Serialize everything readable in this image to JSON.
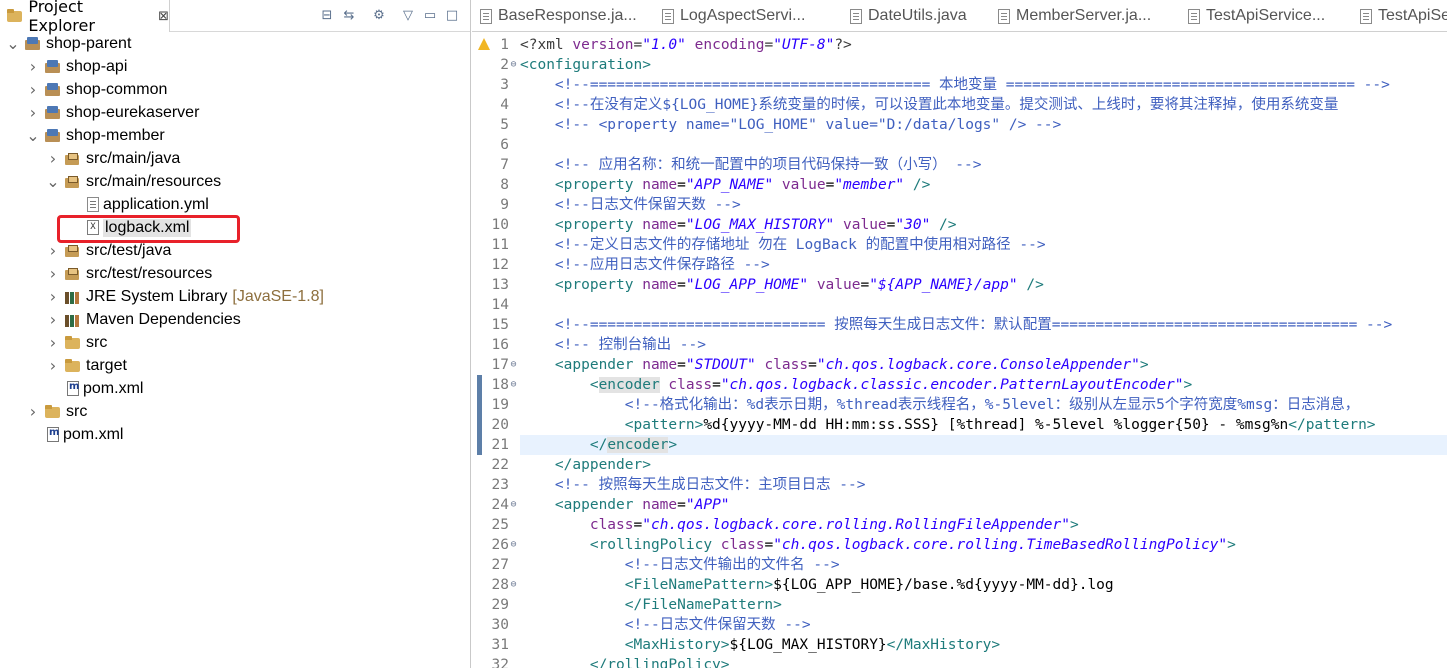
{
  "explorer": {
    "title": "Project Explorer",
    "close": "⊠",
    "toolbar": [
      "collapse-all-icon",
      "link-with-editor-icon",
      "filter-icon",
      "view-menu-icon",
      "minimize-icon",
      "maximize-icon"
    ],
    "tree": [
      {
        "label": "shop-parent",
        "icon": "project-icon",
        "indent": 0,
        "twisty": "v"
      },
      {
        "label": "shop-api",
        "icon": "project-icon",
        "indent": 1,
        "twisty": ">"
      },
      {
        "label": "shop-common",
        "icon": "project-icon",
        "indent": 1,
        "twisty": ">"
      },
      {
        "label": "shop-eurekaserver",
        "icon": "project-icon",
        "indent": 1,
        "twisty": ">"
      },
      {
        "label": "shop-member",
        "icon": "project-icon",
        "indent": 1,
        "twisty": "v"
      },
      {
        "label": "src/main/java",
        "icon": "package-folder-icon",
        "indent": 2,
        "twisty": ">"
      },
      {
        "label": "src/main/resources",
        "icon": "package-folder-icon",
        "indent": 2,
        "twisty": "v"
      },
      {
        "label": "application.yml",
        "icon": "file-icon",
        "indent": 3,
        "twisty": ""
      },
      {
        "label": "logback.xml",
        "icon": "xml-file-icon",
        "indent": 3,
        "twisty": "",
        "selected": true
      },
      {
        "label": "src/test/java",
        "icon": "package-folder-icon",
        "indent": 2,
        "twisty": ">"
      },
      {
        "label": "src/test/resources",
        "icon": "package-folder-icon",
        "indent": 2,
        "twisty": ">"
      },
      {
        "label": "JRE System Library",
        "decoration": "[JavaSE-1.8]",
        "icon": "library-icon",
        "indent": 2,
        "twisty": ">"
      },
      {
        "label": "Maven Dependencies",
        "icon": "library-icon",
        "indent": 2,
        "twisty": ">"
      },
      {
        "label": "src",
        "icon": "folder-icon",
        "indent": 2,
        "twisty": ">"
      },
      {
        "label": "target",
        "icon": "folder-icon",
        "indent": 2,
        "twisty": ">"
      },
      {
        "label": "pom.xml",
        "icon": "pom-file-icon",
        "indent": 2,
        "twisty": ""
      },
      {
        "label": "src",
        "icon": "folder-icon",
        "indent": 1,
        "twisty": ">"
      },
      {
        "label": "pom.xml",
        "icon": "pom-file-icon",
        "indent": 1,
        "twisty": ""
      }
    ]
  },
  "editor": {
    "tabs": [
      "BaseResponse.ja...",
      "LogAspectServi...",
      "DateUtils.java",
      "MemberServer.ja...",
      "TestApiService...",
      "TestApiSe"
    ],
    "lines": [
      [
        [
          "pi",
          "<?xml "
        ],
        [
          "attr",
          "version"
        ],
        [
          "pi",
          "="
        ],
        [
          "val",
          "\"1.0\""
        ],
        [
          "pi",
          " "
        ],
        [
          "attr",
          "encoding"
        ],
        [
          "pi",
          "="
        ],
        [
          "val",
          "\"UTF-8\""
        ],
        [
          "pi",
          "?>"
        ]
      ],
      [
        [
          "tag",
          "<configuration>"
        ]
      ],
      [
        [
          "cmt",
          "    <!--======================================= 本地变量 ======================================== -->"
        ]
      ],
      [
        [
          "cmt",
          "    <!--在没有定义${LOG_HOME}系统变量的时候，可以设置此本地变量。提交测试、上线时，要将其注释掉，使用系统变量"
        ]
      ],
      [
        [
          "cmt",
          "    <!-- <property name=\"LOG_HOME\" value=\"D:/data/logs\" /> -->"
        ]
      ],
      [
        [
          "txt",
          ""
        ]
      ],
      [
        [
          "cmt",
          "    <!-- 应用名称：和统一配置中的项目代码保持一致（小写） -->"
        ]
      ],
      [
        [
          "tag",
          "    <property "
        ],
        [
          "attr",
          "name"
        ],
        [
          "txt",
          "="
        ],
        [
          "val",
          "\"APP_NAME\""
        ],
        [
          "txt",
          " "
        ],
        [
          "attr",
          "value"
        ],
        [
          "txt",
          "="
        ],
        [
          "val",
          "\"member\""
        ],
        [
          "tag",
          " />"
        ]
      ],
      [
        [
          "cmt",
          "    <!--日志文件保留天数 -->"
        ]
      ],
      [
        [
          "tag",
          "    <property "
        ],
        [
          "attr",
          "name"
        ],
        [
          "txt",
          "="
        ],
        [
          "val",
          "\"LOG_MAX_HISTORY\""
        ],
        [
          "txt",
          " "
        ],
        [
          "attr",
          "value"
        ],
        [
          "txt",
          "="
        ],
        [
          "val",
          "\"30\""
        ],
        [
          "tag",
          " />"
        ]
      ],
      [
        [
          "cmt",
          "    <!--定义日志文件的存储地址 勿在 LogBack 的配置中使用相对路径 -->"
        ]
      ],
      [
        [
          "cmt",
          "    <!--应用日志文件保存路径 -->"
        ]
      ],
      [
        [
          "tag",
          "    <property "
        ],
        [
          "attr",
          "name"
        ],
        [
          "txt",
          "="
        ],
        [
          "val",
          "\"LOG_APP_HOME\""
        ],
        [
          "txt",
          " "
        ],
        [
          "attr",
          "value"
        ],
        [
          "txt",
          "="
        ],
        [
          "val",
          "\"${APP_NAME}/app\""
        ],
        [
          "tag",
          " />"
        ]
      ],
      [
        [
          "txt",
          ""
        ]
      ],
      [
        [
          "cmt",
          "    <!--=========================== 按照每天生成日志文件：默认配置=================================== -->"
        ]
      ],
      [
        [
          "cmt",
          "    <!-- 控制台输出 -->"
        ]
      ],
      [
        [
          "tag",
          "    <appender "
        ],
        [
          "attr",
          "name"
        ],
        [
          "txt",
          "="
        ],
        [
          "val",
          "\"STDOUT\""
        ],
        [
          "txt",
          " "
        ],
        [
          "attr",
          "class"
        ],
        [
          "txt",
          "="
        ],
        [
          "val",
          "\"ch.qos.logback.core.ConsoleAppender\""
        ],
        [
          "tag",
          ">"
        ]
      ],
      [
        [
          "tag",
          "        <"
        ],
        [
          "enc",
          "encoder"
        ],
        [
          "txt",
          " "
        ],
        [
          "attr",
          "class"
        ],
        [
          "txt",
          "="
        ],
        [
          "val",
          "\"ch.qos.logback.classic.encoder.PatternLayoutEncoder\""
        ],
        [
          "tag",
          ">"
        ]
      ],
      [
        [
          "cmt",
          "            <!--格式化输出：%d表示日期，%thread表示线程名，%-5level：级别从左显示5个字符宽度%msg：日志消息，"
        ]
      ],
      [
        [
          "tag",
          "            <pattern>"
        ],
        [
          "txt",
          "%d{yyyy-MM-dd HH:mm:ss.SSS} [%thread] %-5level %logger{50} - %msg%n"
        ],
        [
          "tag",
          "</pattern>"
        ]
      ],
      [
        [
          "tag",
          "        </"
        ],
        [
          "enc",
          "encoder"
        ],
        [
          "tag",
          ">"
        ]
      ],
      [
        [
          "tag",
          "    </appender>"
        ]
      ],
      [
        [
          "cmt",
          "    <!-- 按照每天生成日志文件：主项目日志 -->"
        ]
      ],
      [
        [
          "tag",
          "    <appender "
        ],
        [
          "attr",
          "name"
        ],
        [
          "txt",
          "="
        ],
        [
          "val",
          "\"APP\""
        ]
      ],
      [
        [
          "txt",
          "        "
        ],
        [
          "attr",
          "class"
        ],
        [
          "txt",
          "="
        ],
        [
          "val",
          "\"ch.qos.logback.core.rolling.RollingFileAppender\""
        ],
        [
          "tag",
          ">"
        ]
      ],
      [
        [
          "tag",
          "        <rollingPolicy "
        ],
        [
          "attr",
          "class"
        ],
        [
          "txt",
          "="
        ],
        [
          "val",
          "\"ch.qos.logback.core.rolling.TimeBasedRollingPolicy\""
        ],
        [
          "tag",
          ">"
        ]
      ],
      [
        [
          "cmt",
          "            <!--日志文件输出的文件名 -->"
        ]
      ],
      [
        [
          "tag",
          "            <FileNamePattern>"
        ],
        [
          "txt",
          "${LOG_APP_HOME}/base.%d{yyyy-MM-dd}.log"
        ]
      ],
      [
        [
          "tag",
          "            </FileNamePattern>"
        ]
      ],
      [
        [
          "cmt",
          "            <!--日志文件保留天数 -->"
        ]
      ],
      [
        [
          "tag",
          "            <MaxHistory>"
        ],
        [
          "txt",
          "${LOG_MAX_HISTORY}"
        ],
        [
          "tag",
          "</MaxHistory>"
        ]
      ],
      [
        [
          "tag",
          "        </rollingPolicy>"
        ]
      ]
    ],
    "folds": [
      2,
      17,
      18,
      24,
      26,
      28
    ],
    "current_line": 21,
    "range_lines": [
      18,
      21
    ],
    "warning_line": 1
  }
}
